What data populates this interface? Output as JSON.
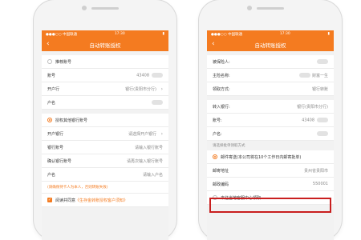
{
  "status_bar": {
    "carrier": "●●●○○ 中国联通",
    "time": "17:30",
    "battery": "▮"
  },
  "title": "自动转账授权",
  "left": {
    "recommend": "推荐账号",
    "account_label": "账号",
    "account_value": "43408",
    "bank_label": "开户行",
    "bank_value": "银行(贵阳市分行)",
    "name_label": "户名",
    "other_option": "授权其他银行账号",
    "open_bank_label": "开户银行",
    "open_bank_placeholder": "请选择开户银行",
    "bank_no_label": "银行账号",
    "bank_no_placeholder": "请输入银行账号",
    "confirm_label": "确认银行账号",
    "confirm_placeholder": "请再次输入银行账号",
    "holder_label": "户名",
    "holder_placeholder": "请输入户名",
    "hint": "(请确保持卡人为本人，否则转账失败)",
    "agree_prefix": "阅读并同意",
    "agree_link": "《生存金转账授权客户须知》"
  },
  "right": {
    "insured_label": "被保险人:",
    "contract_label": "主险名称:",
    "contract_value": "财富一生",
    "method_label": "领取方式:",
    "method_value": "银行转账",
    "transfer_bank_label": "转入银行:",
    "transfer_bank_value": "银行(贵阳市分行)",
    "account_label": "账号:",
    "account_value": "43408",
    "name_label": "户名:",
    "section_label": "请选择批单领取方式",
    "mail_option": "邮件寄送(本公司将在10个工作日内邮寄批单)",
    "address_label": "邮寄地址",
    "address_value": "贵州省贵阳市",
    "postcode_label": "邮政编码",
    "postcode_value": "550001",
    "counter_option": "来往当地客服中心领取"
  }
}
